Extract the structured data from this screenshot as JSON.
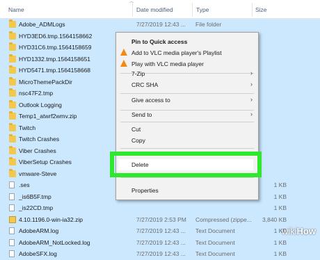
{
  "columns": {
    "name": "Name",
    "date": "Date modified",
    "type": "Type",
    "size": "Size"
  },
  "files": [
    {
      "name": "Adobe_ADMLogs",
      "date": "7/27/2019 12:43 ...",
      "type": "File folder",
      "size": "",
      "icon": "folder-icon",
      "selected": true
    },
    {
      "name": "HYD3ED6.tmp.1564158662",
      "date": "",
      "type": "",
      "size": "",
      "icon": "folder-icon",
      "selected": true
    },
    {
      "name": "HYD31C6.tmp.1564158659",
      "date": "",
      "type": "",
      "size": "",
      "icon": "folder-icon",
      "selected": true
    },
    {
      "name": "HYD1332.tmp.1564158651",
      "date": "",
      "type": "",
      "size": "",
      "icon": "folder-icon",
      "selected": true
    },
    {
      "name": "HYD5471.tmp.1564158668",
      "date": "",
      "type": "",
      "size": "",
      "icon": "folder-icon",
      "selected": true
    },
    {
      "name": "MicroThemePackDir",
      "date": "",
      "type": "",
      "size": "",
      "icon": "folder-icon",
      "selected": true
    },
    {
      "name": "nsc47F2.tmp",
      "date": "",
      "type": "",
      "size": "",
      "icon": "folder-icon",
      "selected": true
    },
    {
      "name": "Outlook Logging",
      "date": "",
      "type": "",
      "size": "",
      "icon": "folder-icon",
      "selected": true
    },
    {
      "name": "Temp1_atwrf2wmv.zip",
      "date": "",
      "type": "",
      "size": "",
      "icon": "folder-icon",
      "selected": true
    },
    {
      "name": "Twitch",
      "date": "",
      "type": "",
      "size": "",
      "icon": "folder-icon",
      "selected": true
    },
    {
      "name": "Twitch Crashes",
      "date": "",
      "type": "",
      "size": "",
      "icon": "folder-icon",
      "selected": true
    },
    {
      "name": "Viber Crashes",
      "date": "",
      "type": "",
      "size": "",
      "icon": "folder-icon",
      "selected": true
    },
    {
      "name": "ViberSetup Crashes",
      "date": "",
      "type": "",
      "size": "",
      "icon": "folder-icon",
      "selected": true
    },
    {
      "name": "vmware-Steve",
      "date": "",
      "type": "",
      "size": "",
      "icon": "folder-icon",
      "selected": true
    },
    {
      "name": ".ses",
      "date": "",
      "type": "",
      "size": "1 KB",
      "icon": "file-icon",
      "selected": true
    },
    {
      "name": "_is6B5F.tmp",
      "date": "",
      "type": "",
      "size": "1 KB",
      "icon": "file-icon",
      "selected": true
    },
    {
      "name": "_is22CD.tmp",
      "date": "",
      "type": "",
      "size": "1 KB",
      "icon": "file-icon",
      "selected": true
    },
    {
      "name": "4.10.1196.0-win-ia32.zip",
      "date": "7/27/2019 2:53 PM",
      "type": "Compressed (zippe...",
      "size": "3,840 KB",
      "icon": "zip-icon",
      "selected": true
    },
    {
      "name": "AdobeARM.log",
      "date": "7/27/2019 12:43 ...",
      "type": "Text Document",
      "size": "1 KB",
      "icon": "file-icon",
      "selected": true
    },
    {
      "name": "AdobeARM_NotLocked.log",
      "date": "7/27/2019 12:43 ...",
      "type": "Text Document",
      "size": "1 KB",
      "icon": "file-icon",
      "selected": true
    },
    {
      "name": "AdobeSFX.log",
      "date": "7/27/2019 12:43 ...",
      "type": "Text Document",
      "size": "1 KB",
      "icon": "file-icon",
      "selected": true
    }
  ],
  "context_menu": {
    "items": [
      {
        "label": "Pin to Quick access",
        "bold": true,
        "arrow": false,
        "icon": ""
      },
      {
        "label": "Add to VLC media player's Playlist",
        "bold": false,
        "arrow": false,
        "icon": "vlc-icon"
      },
      {
        "label": "Play with VLC media player",
        "bold": false,
        "arrow": false,
        "icon": "vlc-icon"
      },
      {
        "label": "7-Zip",
        "bold": false,
        "arrow": true,
        "icon": ""
      },
      {
        "label": "CRC SHA",
        "bold": false,
        "arrow": true,
        "icon": ""
      },
      {
        "label": "Give access to",
        "bold": false,
        "arrow": true,
        "icon": ""
      },
      {
        "label": "Send to",
        "bold": false,
        "arrow": true,
        "icon": ""
      },
      {
        "label": "Cut",
        "bold": false,
        "arrow": false,
        "icon": ""
      },
      {
        "label": "Copy",
        "bold": false,
        "arrow": false,
        "icon": ""
      },
      {
        "label": "Delete",
        "bold": false,
        "arrow": false,
        "icon": ""
      },
      {
        "label": "Properties",
        "bold": false,
        "arrow": false,
        "icon": ""
      }
    ]
  },
  "watermark": {
    "part1": "wiki",
    "part2": "How"
  },
  "colors": {
    "selection": "#cce8ff",
    "highlight": "#2ee82e",
    "folder": "#f4c84a",
    "vlc": "#f08a12"
  }
}
